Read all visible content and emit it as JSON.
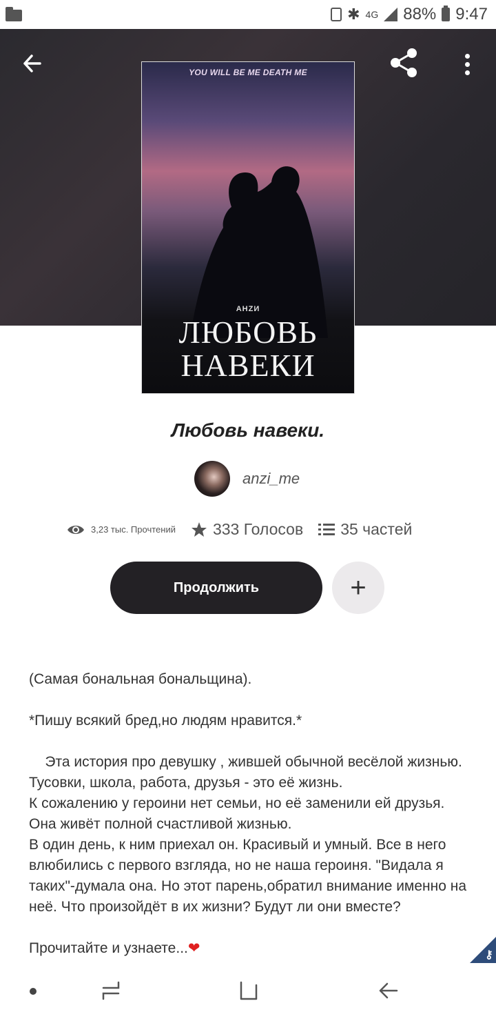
{
  "status_bar": {
    "network": "4G",
    "battery": "88%",
    "time": "9:47"
  },
  "header": {
    "back_icon": "arrow-left-icon",
    "share_icon": "share-icon",
    "more_icon": "more-vertical-icon"
  },
  "cover": {
    "tagline": "YOU WILL BE ME DEATH ME",
    "author": "АНZИ",
    "title_line1": "ЛЮБОВЬ",
    "title_line2": "НАВЕКИ"
  },
  "story": {
    "title": "Любовь навеки.",
    "author": "anzi_me"
  },
  "stats": {
    "reads": "3,23 тыс. Прочтений",
    "votes": "333 Голосов",
    "parts": "35 частей"
  },
  "actions": {
    "continue_label": "Продолжить",
    "add_label": "+"
  },
  "description": {
    "p1": "(Самая бональная бональщина).",
    "p2": "*Пишу всякий бред,но людям нравится.*",
    "p3": "    Эта история про девушку , жившей обычной весёлой жизнью. Тусовки, школа, работа, друзья - это её жизнь.",
    "p4": "К сожалению у героини нет семьи, но её заменили ей друзья. Она живёт полной счастливой жизнью.",
    "p5": "В один день, к ним приехал он. Красивый и умный. Все в него влюбились с первого взгляда, но не наша героиня. \"Видала я таких\"-думала она. Но этот парень,обратил внимание именно на неё. Что произойдёт в их жизни? Будут ли они вместе?",
    "p6": "Прочитайте и узнаете...",
    "heart": "❤"
  },
  "colors": {
    "continue_bg": "#232125",
    "header_bg": "#2b2a2f",
    "heart": "#e02020",
    "badge": "#2e4c7a"
  }
}
